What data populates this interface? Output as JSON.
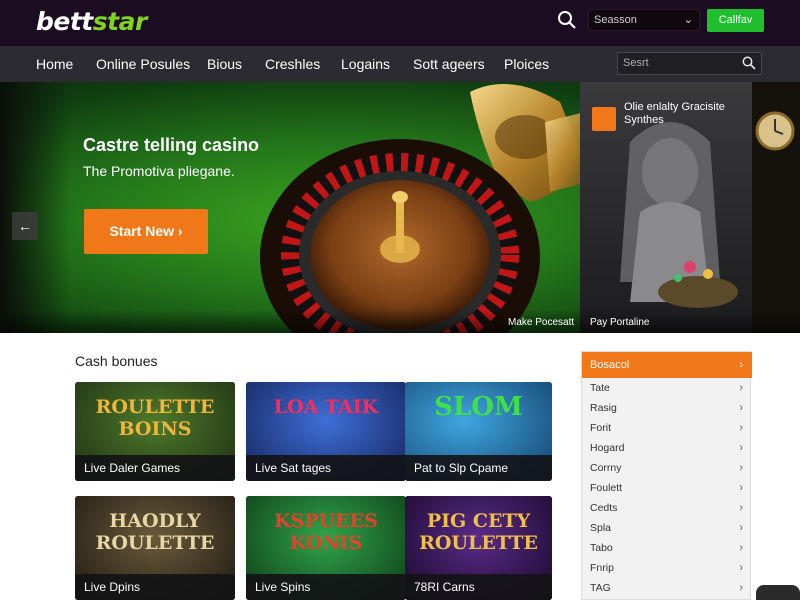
{
  "header": {
    "logo_part1": "bett",
    "logo_part2": "star",
    "select_value": "Seasson",
    "cta_label": "Callfav",
    "brand_green": "#1fbf2e",
    "accent_orange": "#f07818"
  },
  "nav": {
    "items": [
      "Home",
      "Online Posules",
      "Bious",
      "Creshles",
      "Logains",
      "Sott ageers",
      "Ploices"
    ],
    "search_placeholder": "Sesrt"
  },
  "hero": {
    "title": "Castre telling casino",
    "subtitle": "The Promotiva pliegane.",
    "cta": "Start New ›",
    "prev_arrow": "←",
    "side_title": "Olie enlalty Gracisite Synthes",
    "caption_left": "Make Pocesatt",
    "caption_right": "Pay Portaline"
  },
  "section": {
    "title": "Cash bonues",
    "cards": [
      {
        "art_text": "ROULETTE BOINS",
        "label": "Live Daler Games"
      },
      {
        "art_text": "LOA TAIK",
        "label": "Live Sat tages"
      },
      {
        "art_text": "SLOM",
        "label": "Pat to Slp Cpame"
      },
      {
        "art_text": "HAODLY ROULETTE",
        "label": "Live Dpins"
      },
      {
        "art_text": "KSPUEES KONIS",
        "label": "Live Spins"
      },
      {
        "art_text": "PIG CETY ROULETTE",
        "label": "78RI Carns"
      }
    ]
  },
  "sidebar": {
    "header": "Bosacol",
    "items": [
      "Tate",
      "Rasig",
      "Forit",
      "Hogard",
      "Corrny",
      "Foulett",
      "Cedts",
      "Spla",
      "Tabo",
      "Fnrip",
      "TAG"
    ]
  }
}
